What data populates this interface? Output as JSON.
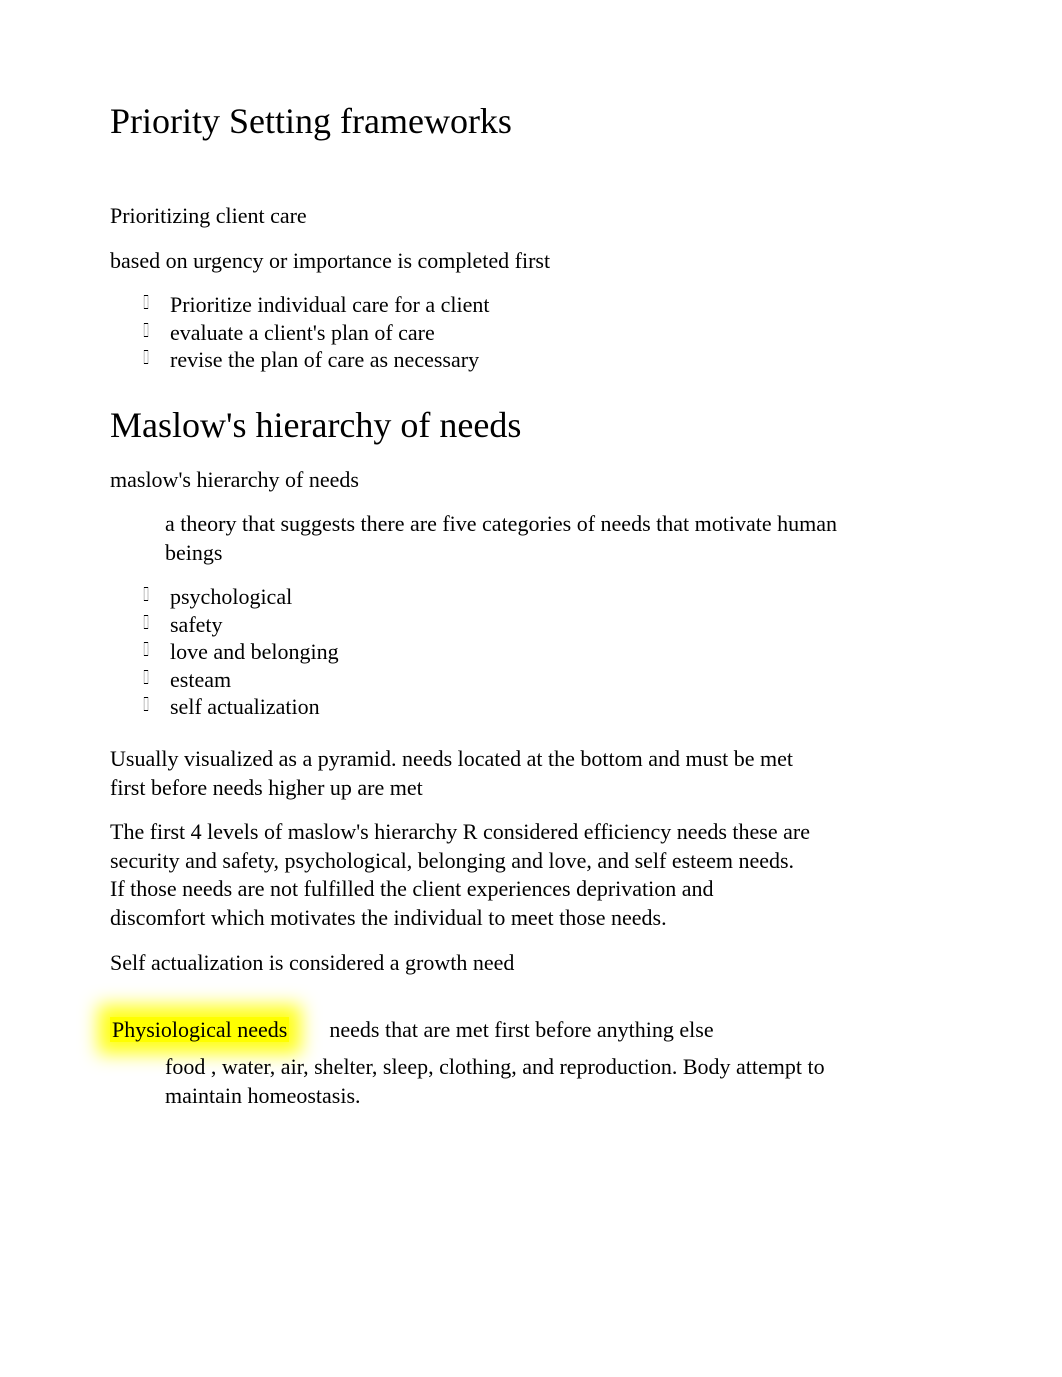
{
  "title1": "Priority Setting frameworks",
  "section1": {
    "p1": "Prioritizing client care",
    "p2": "based on urgency or importance is completed first",
    "bullets": [
      "Prioritize individual care for a client",
      "evaluate a client's plan of care",
      "revise the plan of care as necessary"
    ]
  },
  "title2": "Maslow's hierarchy of needs",
  "section2": {
    "lead": "maslow's hierarchy of needs",
    "def": "a theory that suggests there are five categories of needs that motivate human beings",
    "bullets": [
      "psychological",
      "safety",
      "love and belonging",
      "esteam",
      "self actualization"
    ],
    "p1": "Usually visualized as a pyramid. needs located at the bottom and must be met first before needs higher up are met",
    "p2": "The first 4 levels of maslow's hierarchy R considered efficiency needs these are security and safety, psychological, belonging and love, and self esteem needs. If those needs are not fulfilled the client experiences deprivation and discomfort which motivates the individual to meet those needs.",
    "p3": "Self actualization is considered a growth need"
  },
  "physio": {
    "label": "Physiological needs",
    "desc": "needs that are met first before anything else",
    "detail": "food , water, air, shelter, sleep, clothing, and reproduction. Body attempt to maintain homeostasis."
  }
}
